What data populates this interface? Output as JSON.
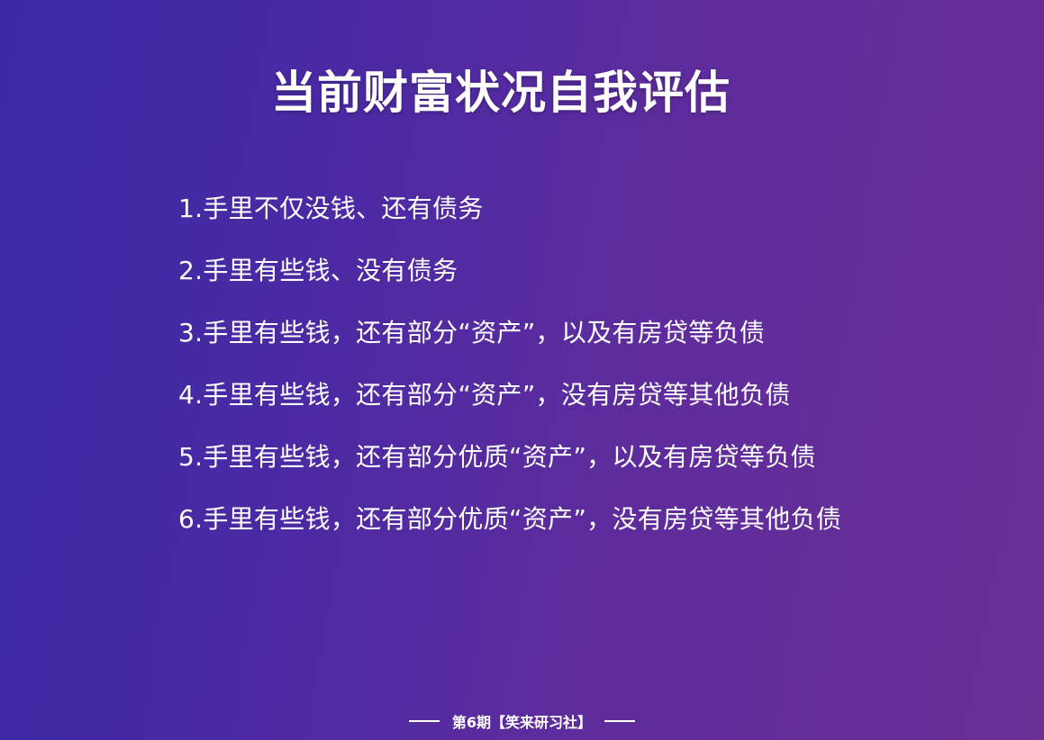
{
  "slide": {
    "title": "当前财富状况自我评估",
    "items": [
      "1.手里不仅没钱、还有债务",
      "2.手里有些钱、没有债务",
      "3.手里有些钱，还有部分“资产”，以及有房贷等负债",
      "4.手里有些钱，还有部分“资产”，没有房贷等其他负债",
      "5.手里有些钱，还有部分优质“资产”，以及有房贷等负债",
      "6.手里有些钱，还有部分优质“资产”，没有房贷等其他负债"
    ],
    "footer": "第6期【笑来研习社】"
  },
  "colors": {
    "background_start": "#3a2aa6",
    "background_end": "#6b2f95",
    "text": "#ffffff"
  }
}
